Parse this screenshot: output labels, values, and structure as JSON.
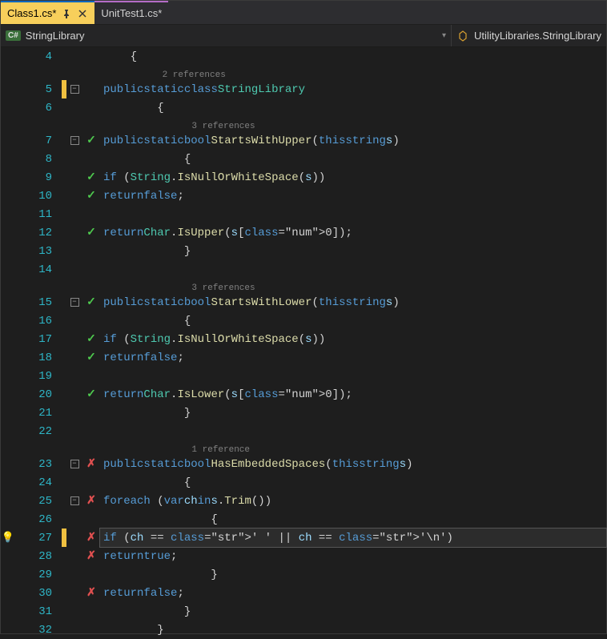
{
  "tabs": [
    {
      "label": "Class1.cs*",
      "active": true
    },
    {
      "label": "UnitTest1.cs*",
      "active": false
    }
  ],
  "nav": {
    "left_badge": "C#",
    "left_label": "StringLibrary",
    "right_label": "UtilityLibraries.StringLibrary"
  },
  "references": {
    "cls": "2 references",
    "upper": "3 references",
    "lower": "3 references",
    "embedded": "1 reference"
  },
  "lines": {
    "4": "    {",
    "5": "        public static class StringLibrary",
    "6": "        {",
    "7": "            public static bool StartsWithUpper(this string s)",
    "8": "            {",
    "9": "                if (String.IsNullOrWhiteSpace(s))",
    "10": "                    return false;",
    "11": "",
    "12": "                return Char.IsUpper(s[0]);",
    "13": "            }",
    "14": "",
    "15": "            public static bool StartsWithLower(this string s)",
    "16": "            {",
    "17": "                if (String.IsNullOrWhiteSpace(s))",
    "18": "                    return false;",
    "19": "",
    "20": "                return Char.IsLower(s[0]);",
    "21": "            }",
    "22": "",
    "23": "            public static bool HasEmbeddedSpaces(this string s)",
    "24": "            {",
    "25": "                foreach (var ch in s.Trim())",
    "26": "                {",
    "27": "                    if (ch == ' ' || ch == '\\n')",
    "28": "                        return true;",
    "29": "                }",
    "30": "                return false;",
    "31": "            }",
    "32": "        }"
  },
  "line_meta": {
    "5": {
      "change": "yellow",
      "fold": true
    },
    "7": {
      "fold": true,
      "status": "ok"
    },
    "9": {
      "status": "ok"
    },
    "10": {
      "status": "ok"
    },
    "12": {
      "status": "ok"
    },
    "15": {
      "fold": true,
      "status": "ok"
    },
    "17": {
      "status": "ok"
    },
    "18": {
      "status": "ok"
    },
    "20": {
      "status": "ok"
    },
    "23": {
      "fold": true,
      "status": "fail"
    },
    "25": {
      "fold": true,
      "status": "fail"
    },
    "27": {
      "change": "yellow",
      "status": "fail",
      "bulb": true,
      "highlighted": true
    },
    "28": {
      "status": "fail"
    },
    "30": {
      "status": "fail"
    }
  },
  "line_order": [
    "4",
    "ref_cls",
    "5",
    "6",
    "ref_upper",
    "7",
    "8",
    "9",
    "10",
    "11",
    "12",
    "13",
    "14",
    "ref_lower",
    "15",
    "16",
    "17",
    "18",
    "19",
    "20",
    "21",
    "22",
    "ref_embedded",
    "23",
    "24",
    "25",
    "26",
    "27",
    "28",
    "29",
    "30",
    "31",
    "32"
  ]
}
